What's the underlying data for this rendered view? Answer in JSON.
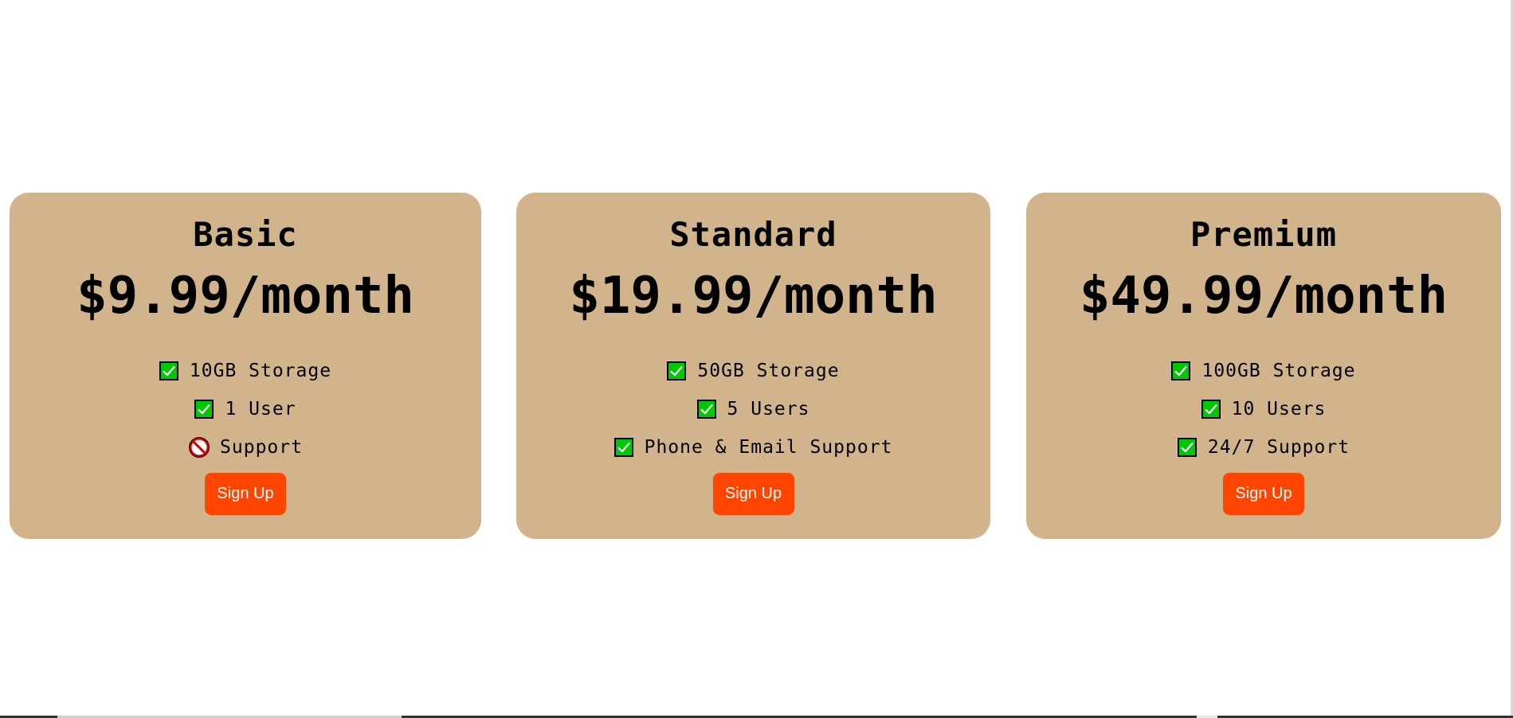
{
  "plans": [
    {
      "name": "Basic",
      "price": "$9.99/month",
      "features": [
        {
          "icon": "check-icon",
          "text": "10GB Storage",
          "included": true
        },
        {
          "icon": "no-entry-icon",
          "text": "Support",
          "included": false
        },
        {
          "icon": "check-icon",
          "text": "1 User",
          "included": true
        }
      ],
      "button_label": "Sign Up"
    },
    {
      "name": "Standard",
      "price": "$19.99/month",
      "features": [
        {
          "icon": "check-icon",
          "text": "50GB Storage",
          "included": true
        },
        {
          "icon": "check-icon",
          "text": "5 Users",
          "included": true
        },
        {
          "icon": "check-icon",
          "text": "Phone & Email Support",
          "included": true
        }
      ],
      "button_label": "Sign Up"
    },
    {
      "name": "Premium",
      "price": "$49.99/month",
      "features": [
        {
          "icon": "check-icon",
          "text": "100GB Storage",
          "included": true
        },
        {
          "icon": "check-icon",
          "text": "10 Users",
          "included": true
        },
        {
          "icon": "check-icon",
          "text": "24/7 Support",
          "included": true
        }
      ],
      "button_label": "Sign Up"
    }
  ],
  "colors": {
    "card_background": "#d2b48c",
    "button_background": "#ff4500",
    "button_text": "#ffffff",
    "check_fill": "#00c800",
    "no_entry": "#cc0000"
  }
}
